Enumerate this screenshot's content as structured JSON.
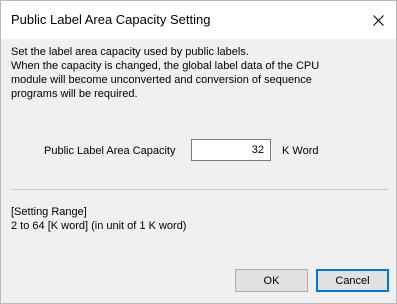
{
  "window": {
    "title": "Public Label Area Capacity Setting"
  },
  "description": {
    "lines": [
      "Set the label area capacity used by public labels.",
      "When the capacity is changed, the global label data of the CPU",
      "module will become unconverted and conversion of sequence",
      "programs will be required."
    ]
  },
  "capacity": {
    "label": "Public Label Area Capacity",
    "value": "32",
    "unit": "K Word"
  },
  "setting_range": {
    "heading": "[Setting Range]",
    "text": "2 to 64 [K word] (in unit of 1 K word)"
  },
  "buttons": {
    "ok_label": "OK",
    "cancel_label": "Cancel"
  },
  "icons": {
    "close": "close-icon"
  },
  "colors": {
    "dialog_background": "#f0f0f0",
    "titlebar_background": "#ffffff",
    "default_button_border": "#0078d7"
  }
}
